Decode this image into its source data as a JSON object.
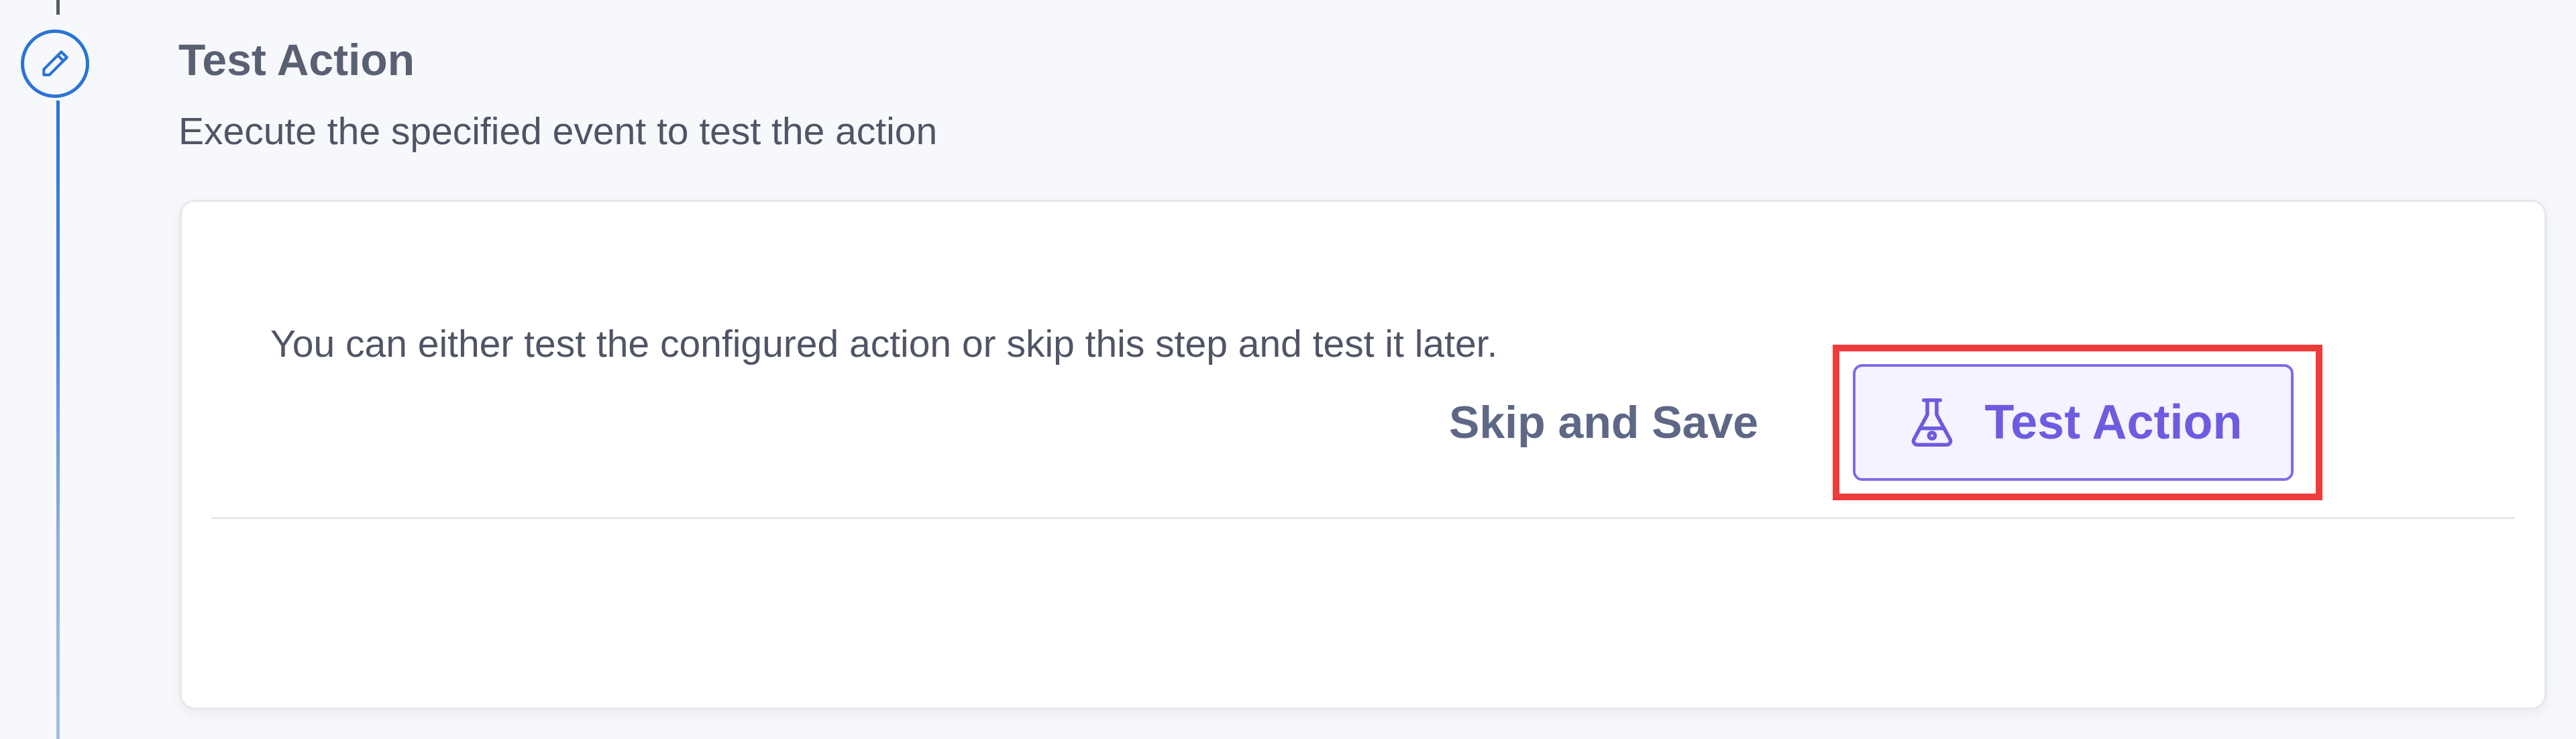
{
  "step": {
    "title": "Test Action",
    "subtitle": "Execute the specified event to test the action",
    "icon": "pencil-icon"
  },
  "card": {
    "message": "You can either test the configured action or skip this step and test it later."
  },
  "actions": {
    "skip_label": "Skip and Save",
    "test_label": "Test Action",
    "test_icon": "flask-icon",
    "highlighted": "test-action-button"
  },
  "colors": {
    "timeline_accent": "#2b74d6",
    "primary_button": "#6d5ce0",
    "primary_button_bg": "#f5f3ff",
    "highlight_frame": "#ee3b3b",
    "page_background": "#f7f8fb"
  }
}
